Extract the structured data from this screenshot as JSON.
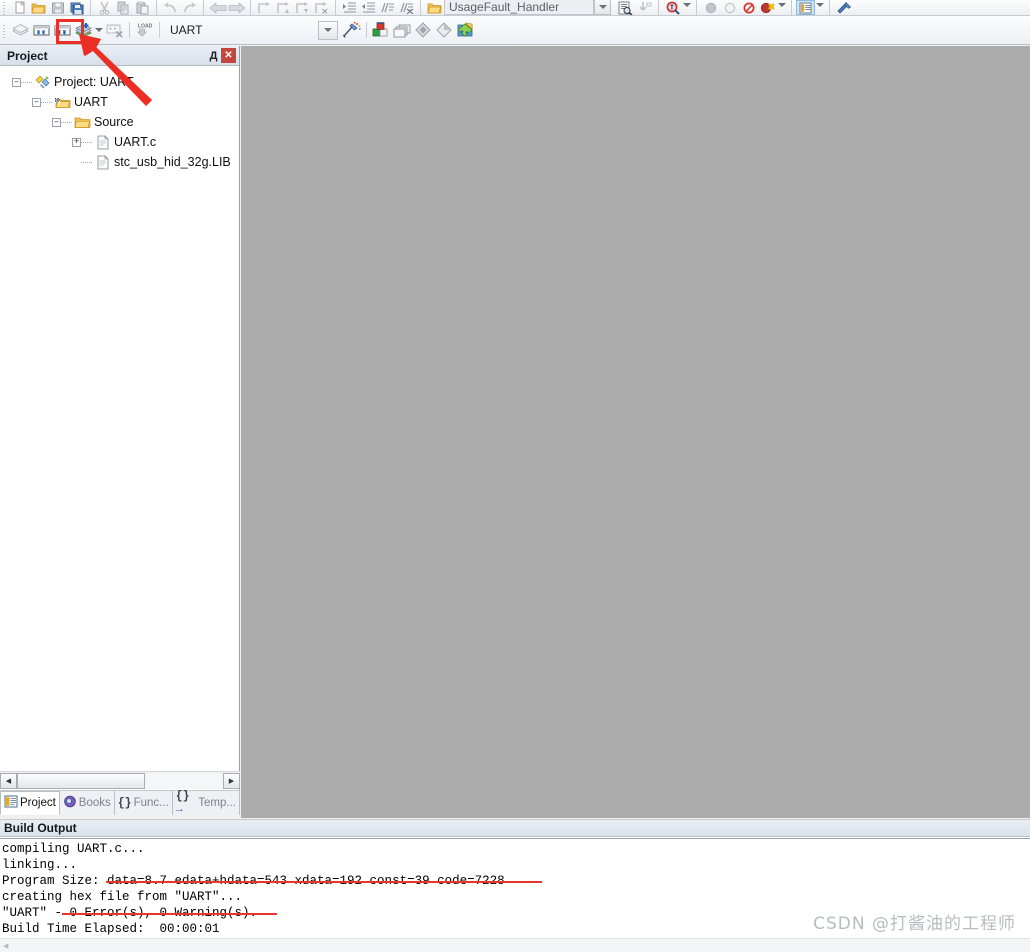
{
  "toolbar_row1": {
    "groups": [
      {
        "name": "file",
        "items": [
          {
            "icon": "new-file-icon",
            "label": "New"
          },
          {
            "icon": "open-folder-icon",
            "label": "Open"
          },
          {
            "icon": "save-icon",
            "label": "Save"
          },
          {
            "icon": "save-all-icon",
            "label": "Save All"
          }
        ]
      },
      {
        "name": "clipboard",
        "items": [
          {
            "icon": "cut-icon",
            "label": "Cut"
          },
          {
            "icon": "copy-icon",
            "label": "Copy"
          },
          {
            "icon": "paste-icon",
            "label": "Paste"
          }
        ]
      },
      {
        "name": "history",
        "items": [
          {
            "icon": "undo-icon",
            "label": "Undo"
          },
          {
            "icon": "redo-icon",
            "label": "Redo"
          }
        ]
      },
      {
        "name": "navigate",
        "items": [
          {
            "icon": "navigate-back-icon",
            "label": "Back"
          },
          {
            "icon": "navigate-forward-icon",
            "label": "Forward"
          }
        ]
      },
      {
        "name": "bookmarks",
        "items": [
          {
            "icon": "bookmark-toggle-icon",
            "label": "Insert/Remove Bookmark"
          },
          {
            "icon": "bookmark-prev-icon",
            "label": "Previous Bookmark"
          },
          {
            "icon": "bookmark-next-icon",
            "label": "Next Bookmark"
          },
          {
            "icon": "bookmark-clear-icon",
            "label": "Clear All Bookmarks"
          }
        ]
      },
      {
        "name": "indent",
        "items": [
          {
            "icon": "indent-increase-icon",
            "label": "Indent"
          },
          {
            "icon": "indent-decrease-icon",
            "label": "Outdent"
          },
          {
            "icon": "comment-icon",
            "label": "Comment"
          },
          {
            "icon": "uncomment-icon",
            "label": "Uncomment"
          }
        ]
      }
    ],
    "handler_combo": {
      "icon": "open-file-icon",
      "value": "UsageFault_Handler"
    },
    "debug_items": [
      {
        "icon": "bookmark-list-icon",
        "label": "Bookmarks"
      },
      {
        "icon": "download-flag-icon",
        "label": "Download"
      },
      {
        "icon": "find-in-files-icon",
        "label": "Find in Files"
      },
      {
        "icon": "breakpoint-filled-icon",
        "label": "Insert Breakpoint"
      },
      {
        "icon": "breakpoint-empty-icon",
        "label": "Disable Breakpoint"
      },
      {
        "icon": "breakpoint-clear-icon",
        "label": "Kill All Breakpoints"
      },
      {
        "icon": "breakpoint-disable-icon",
        "label": "Disable All Breakpoints"
      },
      {
        "icon": "window-layout-icon",
        "label": "Window Layout"
      },
      {
        "icon": "configure-icon",
        "label": "Configuration Wizard"
      }
    ]
  },
  "toolbar_row2": {
    "items": [
      {
        "icon": "translate-icon",
        "label": "Translate"
      },
      {
        "icon": "build-icon",
        "label": "Build"
      },
      {
        "icon": "rebuild-icon",
        "label": "Rebuild"
      },
      {
        "icon": "batch-build-icon",
        "label": "Batch Build"
      },
      {
        "icon": "stop-build-icon",
        "label": "Stop Build"
      },
      {
        "icon": "download-icon",
        "label": "Download"
      }
    ],
    "target_value": "UART",
    "right_items": [
      {
        "icon": "target-options-icon",
        "label": "Options for Target"
      },
      {
        "icon": "manage-project-icon",
        "label": "Manage Project Items"
      },
      {
        "icon": "books-window-icon",
        "label": "Books Window"
      },
      {
        "icon": "functions-window-icon",
        "label": "Functions Window"
      },
      {
        "icon": "templates-window-icon",
        "label": "Templates Window"
      },
      {
        "icon": "source-browser-icon",
        "label": "Source Browser"
      }
    ]
  },
  "project_panel": {
    "title": "Project",
    "pin_glyph": "Д",
    "close_glyph": "✕",
    "tree": [
      {
        "depth": 0,
        "toggle": "minus",
        "icon": "project-icon",
        "label": "Project: UART"
      },
      {
        "depth": 1,
        "toggle": "minus",
        "icon": "target-folder-icon",
        "label": "UART"
      },
      {
        "depth": 2,
        "toggle": "minus",
        "icon": "folder-icon",
        "label": "Source"
      },
      {
        "depth": 3,
        "toggle": "plus",
        "icon": "c-file-icon",
        "label": "UART.c"
      },
      {
        "depth": 3,
        "toggle": "none",
        "icon": "lib-file-icon",
        "label": "stc_usb_hid_32g.LIB"
      }
    ],
    "tabs": [
      {
        "icon": "project-tab-icon",
        "label": "Project",
        "active": true
      },
      {
        "icon": "books-tab-icon",
        "label": "Books",
        "active": false
      },
      {
        "icon": "functions-tab-icon",
        "label": "Func...",
        "active": false
      },
      {
        "icon": "templates-tab-icon",
        "label": "Temp...",
        "active": false
      }
    ]
  },
  "build_output": {
    "title": "Build Output",
    "lines": [
      "compiling UART.c...",
      "linking...",
      "Program Size: data=8.7 edata+hdata=543 xdata=192 const=39 code=7228",
      "creating hex file from \"UART\"...",
      "\"UART\" - 0 Error(s), 0 Warning(s).",
      "Build Time Elapsed:  00:00:01"
    ]
  },
  "annotations": {
    "highlight_label": "rebuild-button-highlight",
    "arrow_label": "pointer-arrow",
    "accent_color": "#ec2e24"
  },
  "watermark": {
    "text": "CSDN @打酱油的工程师"
  }
}
